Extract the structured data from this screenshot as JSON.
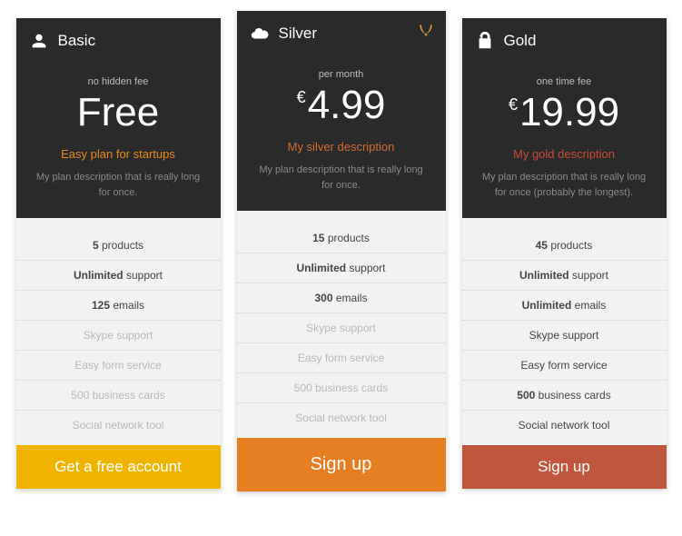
{
  "plans": [
    {
      "id": "basic",
      "title": "Basic",
      "fee_label": "no hidden fee",
      "currency": "",
      "price": "Free",
      "tagline": "Easy plan for startups",
      "tagline_class": "orange",
      "longdesc": "My plan description that is really long for once.",
      "cta": "Get a free account",
      "cta_class": "yellow",
      "featured": false,
      "icon": "person-icon",
      "badge": false,
      "features": [
        {
          "bold": "5",
          "text": "products",
          "enabled": true
        },
        {
          "bold": "Unlimited",
          "text": "support",
          "enabled": true
        },
        {
          "bold": "125",
          "text": "emails",
          "enabled": true
        },
        {
          "bold": "",
          "text": "Skype support",
          "enabled": false
        },
        {
          "bold": "",
          "text": "Easy form service",
          "enabled": false
        },
        {
          "bold": "",
          "text": "500 business cards",
          "enabled": false
        },
        {
          "bold": "",
          "text": "Social network tool",
          "enabled": false
        }
      ]
    },
    {
      "id": "silver",
      "title": "Silver",
      "fee_label": "per month",
      "currency": "€",
      "price": "4.99",
      "tagline": "My silver description",
      "tagline_class": "orangered",
      "longdesc": "My plan description that is really long for once.",
      "cta": "Sign up",
      "cta_class": "orange",
      "featured": true,
      "icon": "cloud-icon",
      "badge": true,
      "features": [
        {
          "bold": "15",
          "text": "products",
          "enabled": true
        },
        {
          "bold": "Unlimited",
          "text": "support",
          "enabled": true
        },
        {
          "bold": "300",
          "text": "emails",
          "enabled": true
        },
        {
          "bold": "",
          "text": "Skype support",
          "enabled": false
        },
        {
          "bold": "",
          "text": "Easy form service",
          "enabled": false
        },
        {
          "bold": "",
          "text": "500 business cards",
          "enabled": false
        },
        {
          "bold": "",
          "text": "Social network tool",
          "enabled": false
        }
      ]
    },
    {
      "id": "gold",
      "title": "Gold",
      "fee_label": "one time fee",
      "currency": "€",
      "price": "19.99",
      "tagline": "My gold description",
      "tagline_class": "red",
      "longdesc": "My plan description that is really long for once (probably the longest).",
      "cta": "Sign up",
      "cta_class": "red",
      "featured": false,
      "icon": "lock-icon",
      "badge": false,
      "features": [
        {
          "bold": "45",
          "text": "products",
          "enabled": true
        },
        {
          "bold": "Unlimited",
          "text": "support",
          "enabled": true
        },
        {
          "bold": "Unlimited",
          "text": "emails",
          "enabled": true
        },
        {
          "bold": "",
          "text": "Skype support",
          "enabled": true
        },
        {
          "bold": "",
          "text": "Easy form service",
          "enabled": true
        },
        {
          "bold": "500",
          "text": "business cards",
          "enabled": true
        },
        {
          "bold": "",
          "text": "Social network tool",
          "enabled": true
        }
      ]
    }
  ]
}
